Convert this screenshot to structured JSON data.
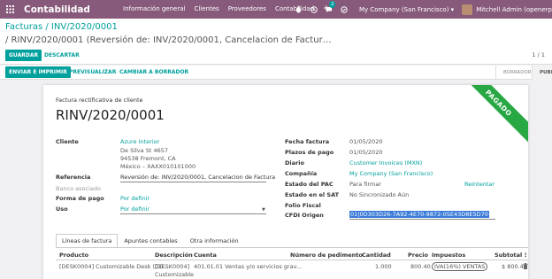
{
  "navbar": {
    "brand": "Contabilidad",
    "menu": [
      "Información general",
      "Clientes",
      "Proveedores",
      "Contabilidad"
    ],
    "plus": "+",
    "messages_count": "2",
    "company": "My Company (San Francisco)",
    "user": "Mitchell Admin (openerp"
  },
  "breadcrumb": {
    "parent": "Facturas",
    "sep": "/",
    "current": "INV/2020/0001",
    "line2": "/ RINV/2020/0001 (Reversión de: INV/2020/0001, Cancelacion de Factur…"
  },
  "actions": {
    "save": "GUARDAR",
    "discard": "DESCARTAR"
  },
  "pager": "1 / 1",
  "statusbar": {
    "send_print": "ENVIAR E IMPRIMIR",
    "preview": "PREVISUALIZAR",
    "reset_draft": "CAMBIAR A BORRADOR",
    "stages": [
      "BORRADOR",
      "PUBL"
    ]
  },
  "doc": {
    "type": "Factura rectificativa de cliente",
    "name": "RINV/2020/0001",
    "ribbon": "PAGADO"
  },
  "left": {
    "cliente_label": "Cliente",
    "cliente_name": "Azure Interior",
    "addr1": "De Silva St 4657",
    "addr2": "94538 Fremont, CA",
    "addr3": "México – XAXX010101000",
    "ref_label": "Referencia",
    "ref_value": "Reversión de: INV/2020/0001, Cancelacion de Factura",
    "bank_label": "Banco asociado",
    "pay_label": "Forma de pago",
    "pay_value": "Por definir",
    "uso_label": "Uso",
    "uso_value": "Por definir"
  },
  "right": {
    "fecha_label": "Fecha factura",
    "fecha_value": "01/05/2020",
    "plazos_label": "Plazos de pago",
    "plazos_value": "01/05/2020",
    "diario_label": "Diario",
    "diario_value": "Customer Invoices (MXN)",
    "company_label": "Compañía",
    "company_value": "My Company (San Francisco)",
    "pac_label": "Estado del PAC",
    "pac_value": "Para firmar",
    "retry": "Reintentar",
    "sat_label": "Estado en el SAT",
    "sat_value": "No Sincronizado Aún",
    "folio_label": "Folio Fiscal",
    "cfdi_label": "CFDI Origen",
    "cfdi_value": "01|0D303D26-7A92-4E70-9872-05E43D8E5D70"
  },
  "tabs": [
    "Líneas de factura",
    "Apuntes contables",
    "Otra información"
  ],
  "table": {
    "headers": [
      "Producto",
      "Descripción",
      "Cuenta",
      "Número de pedimento",
      "Cantidad",
      "Precio",
      "Impuestos",
      "Subtotal"
    ],
    "row": {
      "producto": "[DESK0004] Customizable Desk (CO...",
      "descripcion": "[DESK0004]",
      "descripcion2": "Customizable",
      "cuenta": "401.01.01 Ventas y/o servicios grav...",
      "cantidad": "1.000",
      "precio": "800.40",
      "impuestos": "IVA(16%) VENTAS",
      "subtotal": "$ 800.40"
    }
  },
  "colors": {
    "brand": "#875a7b",
    "accent": "#00a09d",
    "ribbon": "#28a745"
  }
}
